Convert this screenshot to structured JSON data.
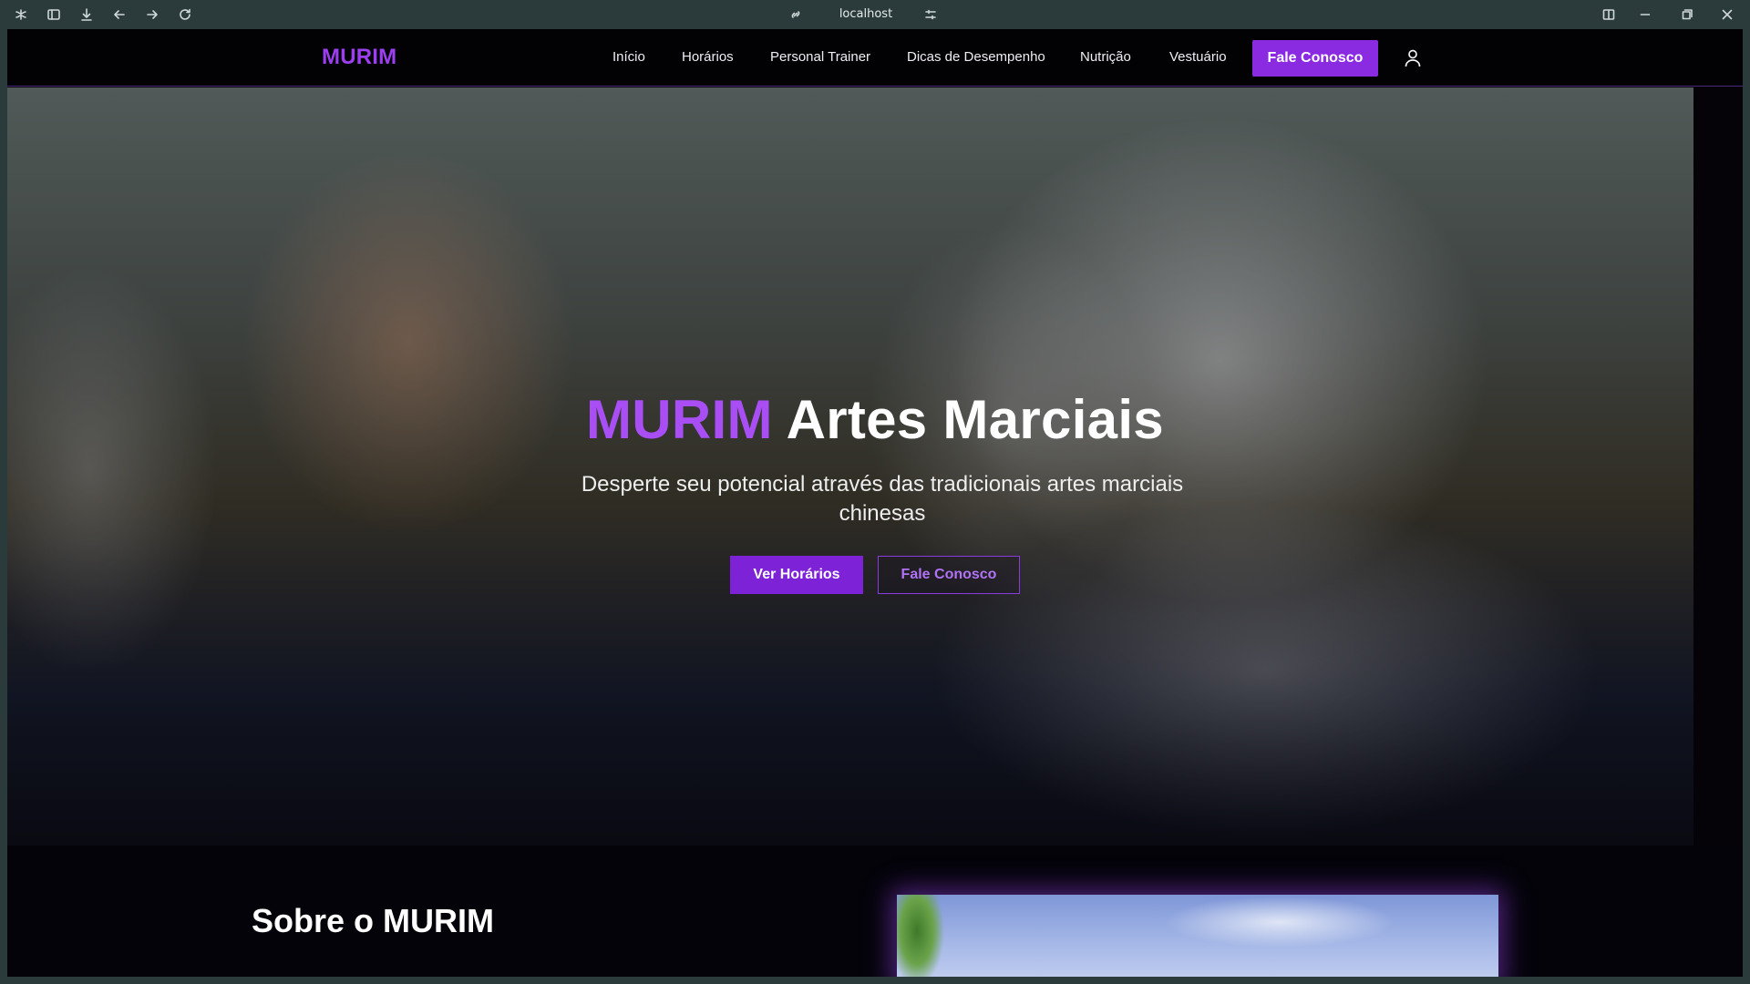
{
  "browser": {
    "url": "localhost",
    "icons": [
      "app-menu-icon",
      "sidebar-icon",
      "download-icon",
      "back-icon",
      "forward-icon",
      "reload-icon",
      "link-icon",
      "site-settings-icon",
      "split-view-icon",
      "minimize-icon",
      "restore-icon",
      "close-icon"
    ]
  },
  "nav": {
    "logo": "MURIM",
    "links": [
      "Início",
      "Horários",
      "Personal Trainer",
      "Dicas de Desempenho",
      "Nutrição",
      "Vestuário"
    ],
    "cta": "Fale Conosco",
    "user_icon": "user-icon"
  },
  "hero": {
    "title_accent": "MURIM",
    "title_rest": "Artes Marciais",
    "subtitle": "Desperte seu potencial através das tradicionais artes marciais chinesas",
    "primary_button": "Ver Horários",
    "secondary_button": "Fale Conosco"
  },
  "about": {
    "title": "Sobre o MURIM"
  },
  "colors": {
    "accent": "#8a2be2",
    "accent_text": "#a94ef5",
    "background": "#050308",
    "chrome": "#2b3a3a"
  }
}
